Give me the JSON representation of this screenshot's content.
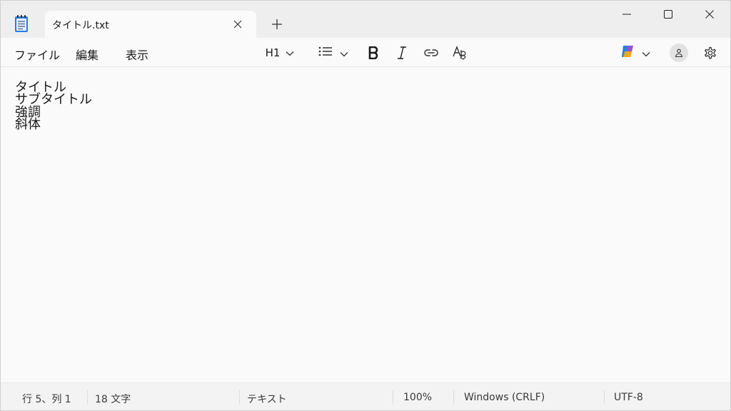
{
  "tab": {
    "title": "タイトル.txt"
  },
  "menu": {
    "file": "ファイル",
    "edit": "編集",
    "view": "表示"
  },
  "toolbar": {
    "heading_label": "H1"
  },
  "editor": {
    "lines": [
      "タイトル",
      "サブタイトル",
      "強調",
      "斜体"
    ]
  },
  "status": {
    "position": "行 5、列 1",
    "char_count": "18 文字",
    "format": "テキスト",
    "zoom": "100%",
    "line_ending": "Windows (CRLF)",
    "encoding": "UTF-8"
  },
  "icons": {
    "app": "notepad-icon",
    "tab_close": "close-icon",
    "new_tab": "plus-icon",
    "minimize": "minimize-icon",
    "maximize": "maximize-icon",
    "close": "close-icon",
    "heading_dropdown": "chevron-down-icon",
    "list": "bulleted-list-icon",
    "bold": "bold-icon",
    "italic": "italic-icon",
    "link": "link-icon",
    "clear_format": "clear-formatting-icon",
    "copilot": "copilot-icon",
    "account": "account-icon",
    "settings": "gear-icon"
  },
  "colors": {
    "titlebar": "#eeeeee",
    "editor_bg": "#fafafa",
    "statusbar": "#f3f3f3",
    "accent_blue": "#2a7de1"
  }
}
